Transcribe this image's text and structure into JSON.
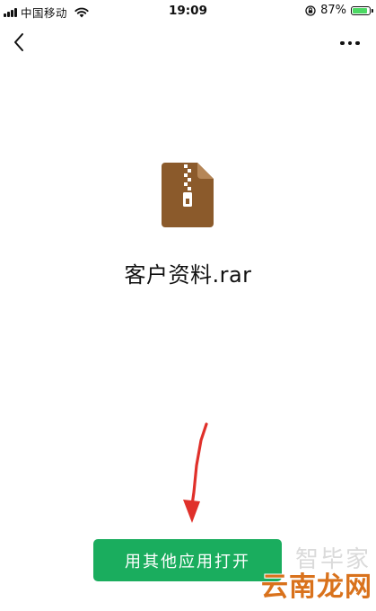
{
  "status_bar": {
    "carrier": "中国移动",
    "time": "19:09",
    "battery_percent": "87%",
    "battery_level": 0.87,
    "icons": [
      "signal-icon",
      "wifi-icon",
      "rotation-lock-icon",
      "battery-icon"
    ]
  },
  "nav": {
    "back_icon": "chevron-left-icon",
    "more_icon": "more-dots-icon"
  },
  "file": {
    "icon": "zip-archive-icon",
    "name": "客户资料.rar",
    "icon_color": "#8b5a2b"
  },
  "actions": {
    "open_with_other_app": "用其他应用打开",
    "button_color": "#1aad5e"
  },
  "annotation": {
    "arrow_icon": "red-arrow-icon",
    "arrow_color": "#e0302a"
  },
  "watermarks": {
    "top": "智毕家",
    "main": "云南龙网"
  }
}
